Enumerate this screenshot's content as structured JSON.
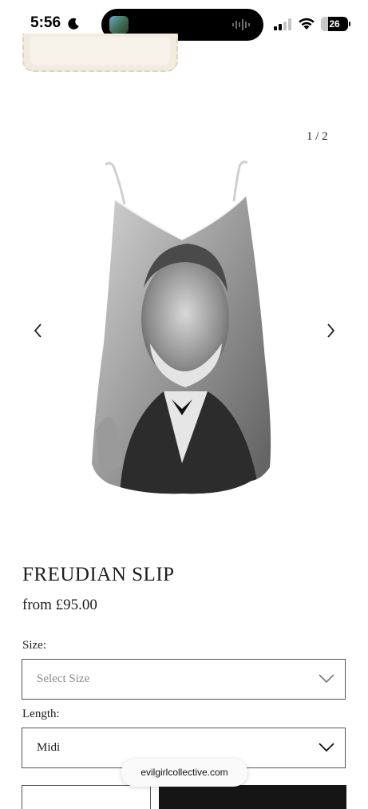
{
  "status_bar": {
    "time": "5:56",
    "focus_icon": "moon-icon",
    "signal_icon": "cellular-signal-icon",
    "wifi_icon": "wifi-icon",
    "battery_level": "26",
    "battery_fraction": 0.26
  },
  "gallery": {
    "counter": "1 / 2",
    "prev_icon": "chevron-left-icon",
    "next_icon": "chevron-right-icon",
    "image_icon": "slip-dress-portrait-photo"
  },
  "product": {
    "title": "FREUDIAN SLIP",
    "price": "from £95.00"
  },
  "options": {
    "size_label": "Size:",
    "size_value": "Select Size",
    "length_label": "Length:",
    "length_value": "Midi"
  },
  "browser": {
    "url": "evilgirlcollective.com"
  },
  "colors": {
    "text": "#1c1c1c",
    "border": "#555555",
    "button_dark": "#151515",
    "background": "#ffffff"
  }
}
